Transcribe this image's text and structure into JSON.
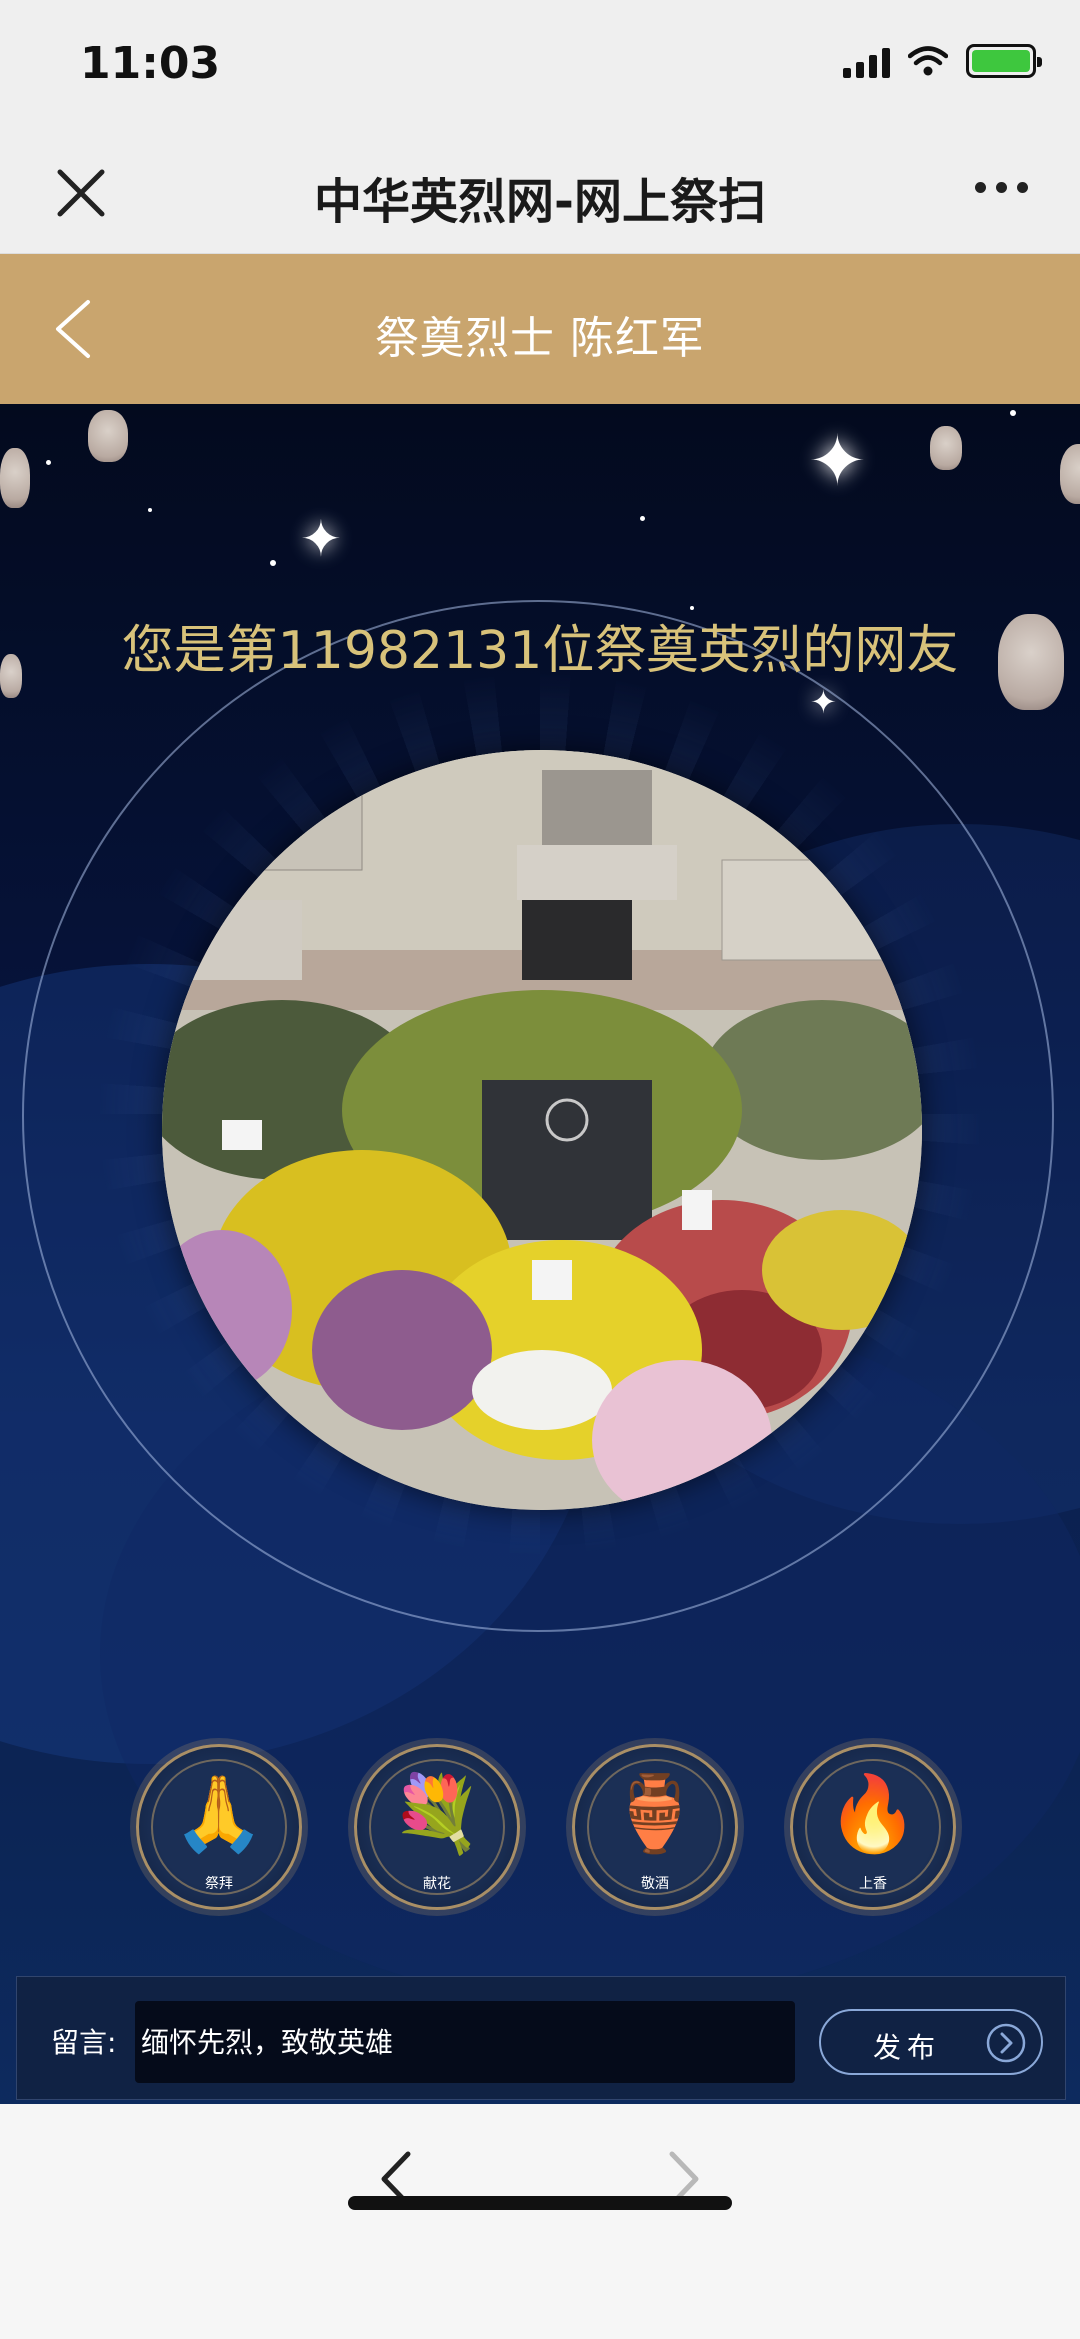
{
  "status_bar": {
    "time": "11:03",
    "battery": "charging"
  },
  "web_nav": {
    "title": "中华英烈网-网上祭扫",
    "close_icon": "close-icon",
    "more_icon": "more-icon"
  },
  "header": {
    "title": "祭奠烈士 陈红军",
    "back_icon": "chevron-left-icon",
    "color": "#c9a56e"
  },
  "scene": {
    "visitor_text": "您是第11982131位祭奠英烈的网友",
    "photo_description_icon": "memorial-photo",
    "accent_color": "#d8c27a"
  },
  "actions": [
    {
      "label": "祭拜",
      "icon": "worship-icon"
    },
    {
      "label": "献花",
      "icon": "flower-bouquet-icon"
    },
    {
      "label": "敬酒",
      "icon": "wine-jar-icon"
    },
    {
      "label": "上香",
      "icon": "incense-burner-icon"
    }
  ],
  "message": {
    "label": "留言:",
    "placeholder": "缅怀先烈，致敬英雄",
    "publish_label": "发布"
  },
  "browser_nav": {
    "back_icon": "chevron-left-icon",
    "forward_icon": "chevron-right-icon"
  }
}
